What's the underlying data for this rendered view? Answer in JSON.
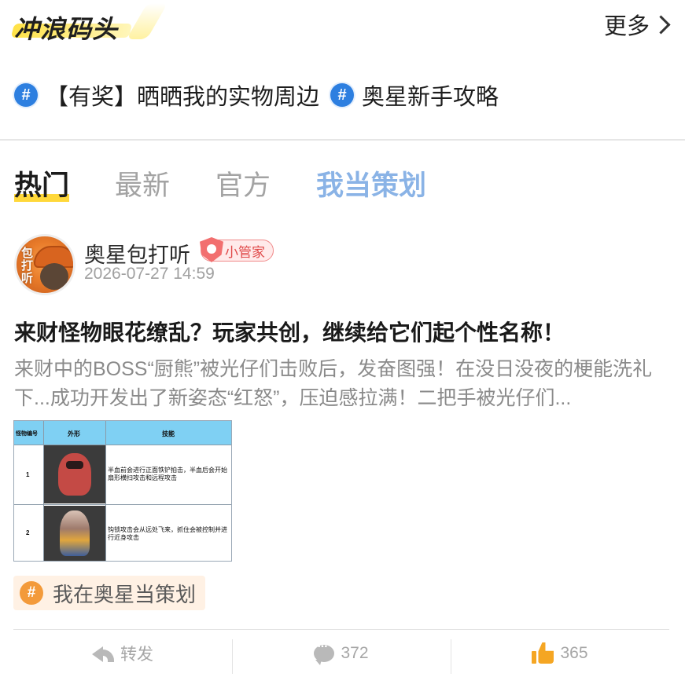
{
  "header": {
    "title": "冲浪码头",
    "more_label": "更多"
  },
  "topics": [
    {
      "label": "【有奖】晒晒我的实物周边",
      "icon": "hash-icon"
    },
    {
      "label": "奥星新手攻略",
      "icon": "hash-icon"
    }
  ],
  "tabs": [
    {
      "label": "热门",
      "active": true
    },
    {
      "label": "最新",
      "active": false
    },
    {
      "label": "官方",
      "active": false
    },
    {
      "label": "我当策划",
      "active": false
    }
  ],
  "post": {
    "author": "奥星包打听",
    "avatar_text": "包打听",
    "badge": "小管家",
    "time": "2026-07-27 14:59",
    "title": "来财怪物眼花缭乱？玩家共创，继续给它们起个性名称！",
    "excerpt": "来财中的BOSS“厨熊”被光仔们击败后，发奋图强！在没日没夜的梗能洗礼下...成功开发出了新姿态“红怒”，压迫感拉满！二把手被光仔们...",
    "image": {
      "headers": [
        "怪物编号",
        "外形",
        "技能"
      ],
      "rows": [
        {
          "num": "1",
          "skill": "半血前会进行正面铁铲拍击，半血后会开始扇形横扫攻击和远程攻击"
        },
        {
          "num": "2",
          "skill": "钩锁攻击会从远处飞来，抓住会被控制并进行近身攻击"
        }
      ]
    },
    "topic_chip": "我在奥星当策划",
    "actions": {
      "share": "转发",
      "comments": "372",
      "likes": "365"
    }
  },
  "colors": {
    "accent_yellow": "#ffd83a",
    "topic_blue": "#2d7fe0",
    "tab_special": "#8ab3e6",
    "like_orange": "#f5a623",
    "badge_red": "#e04848"
  }
}
